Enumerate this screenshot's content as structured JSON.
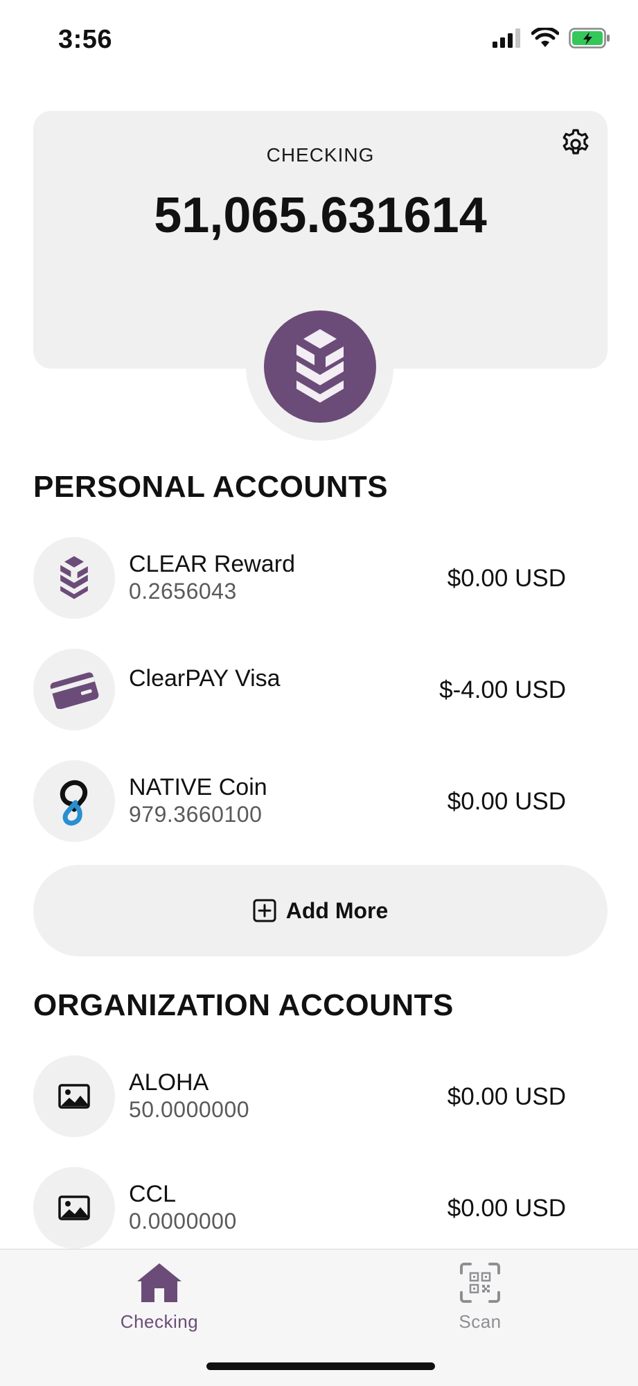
{
  "status_bar": {
    "time": "3:56"
  },
  "balance": {
    "label": "CHECKING",
    "amount": "51,065.631614"
  },
  "personal": {
    "title": "PERSONAL ACCOUNTS",
    "accounts": [
      {
        "name": "CLEAR Reward",
        "quantity": "0.2656043",
        "value": "$0.00 USD",
        "icon": "clear-logo-icon"
      },
      {
        "name": "ClearPAY Visa",
        "quantity": "",
        "value": "$-4.00 USD",
        "icon": "credit-card-icon"
      },
      {
        "name": "NATIVE Coin",
        "quantity": "979.3660100",
        "value": "$0.00 USD",
        "icon": "native-coin-icon"
      }
    ],
    "add_more_label": "Add More"
  },
  "organization": {
    "title": "ORGANIZATION ACCOUNTS",
    "accounts": [
      {
        "name": "ALOHA",
        "quantity": "50.0000000",
        "value": "$0.00 USD",
        "icon": "image-placeholder-icon"
      },
      {
        "name": "CCL",
        "quantity": "0.0000000",
        "value": "$0.00 USD",
        "icon": "image-placeholder-icon"
      }
    ]
  },
  "tabs": [
    {
      "label": "Checking",
      "icon": "home-icon",
      "active": true
    },
    {
      "label": "Scan",
      "icon": "qr-scan-icon",
      "active": false
    }
  ],
  "colors": {
    "brand": "#6b4c78",
    "card_bg": "#f0f0f0",
    "battery": "#34c759",
    "native_blue": "#2a8fd0"
  }
}
